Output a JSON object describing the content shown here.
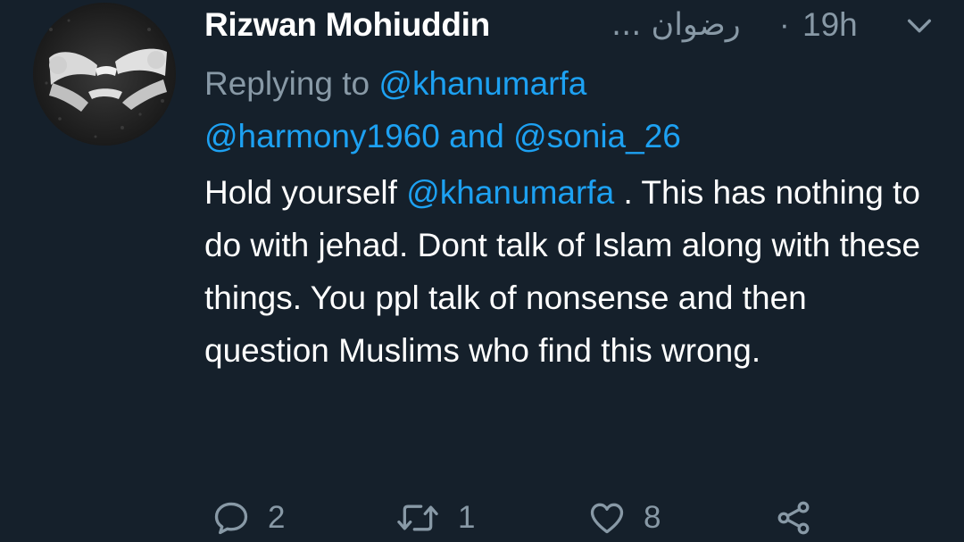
{
  "tweet": {
    "display_name": "Rizwan Mohiuddin",
    "handle": "رضوان ...",
    "separator": "·",
    "time": "19h",
    "replying_prefix": "Replying to",
    "reply_to": [
      "@khanumarfa",
      "@harmony1960",
      "@sonia_26"
    ],
    "reply_and": "and",
    "body_parts": {
      "before_mention": "Hold yourself ",
      "mention": "@khanumarfa",
      "after_mention": " . This has nothing to do with jehad. Dont talk of Islam along with these things. You ppl talk of nonsense and then question Muslims who find this wrong."
    }
  },
  "actions": {
    "reply": {
      "icon": "reply-icon",
      "count": "2"
    },
    "retweet": {
      "icon": "retweet-icon",
      "count": "1"
    },
    "like": {
      "icon": "heart-icon",
      "count": "8"
    },
    "share": {
      "icon": "share-icon"
    }
  },
  "colors": {
    "background": "#15202b",
    "primary_text": "#ffffff",
    "secondary_text": "#8899a6",
    "accent": "#1da1f2"
  }
}
